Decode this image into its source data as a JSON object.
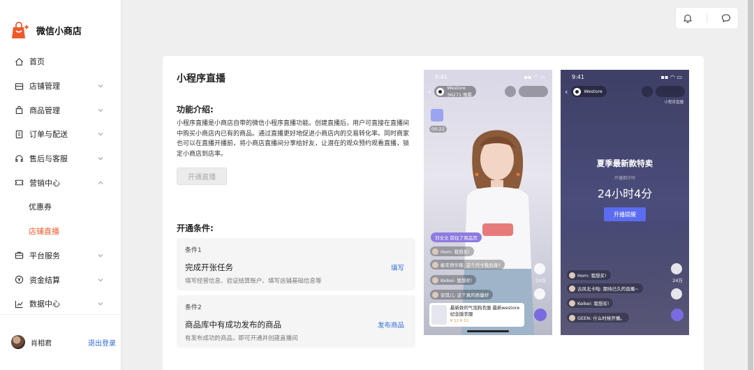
{
  "brand": {
    "name": "微信小商店"
  },
  "nav": {
    "items": [
      {
        "label": "首页",
        "icon": "home-icon",
        "chevron": false
      },
      {
        "label": "店铺管理",
        "icon": "store-icon",
        "chevron": true
      },
      {
        "label": "商品管理",
        "icon": "bag-icon",
        "chevron": true
      },
      {
        "label": "订单与配送",
        "icon": "order-icon",
        "chevron": true
      },
      {
        "label": "售后与客服",
        "icon": "headset-icon",
        "chevron": true
      },
      {
        "label": "营销中心",
        "icon": "ticket-icon",
        "chevron": true,
        "expanded": true
      }
    ],
    "sub_items": [
      {
        "label": "优惠券",
        "active": false
      },
      {
        "label": "店铺直播",
        "active": true
      }
    ],
    "items_after": [
      {
        "label": "平台服务",
        "icon": "briefcase-icon"
      },
      {
        "label": "资金结算",
        "icon": "yen-icon"
      },
      {
        "label": "数据中心",
        "icon": "chart-icon"
      }
    ]
  },
  "user": {
    "name": "肖相君",
    "logout": "退出登录"
  },
  "main": {
    "title": "小程序直播",
    "intro_heading": "功能介绍:",
    "intro_text": "小程序直播是小商店自带的微信小程序直播功能。创建直播后，用户可直接在直播间中购买小商店内已有的商品。通过直播更好地促进小商店内的交易转化率。同时商家也可以在直播开播前，将小商店直播间分享给好友，让潜在的观众预约观看直播，锁定小商店到店率。",
    "open_button": "开通直播",
    "conditions_heading": "开通条件:",
    "conditions": [
      {
        "tag": "条件1",
        "name": "完成开张任务",
        "desc": "填写经营信息、验证结算账户、填写店铺基础信息等",
        "action": "填写"
      },
      {
        "tag": "条件2",
        "name": "商品库中有成功发布的商品",
        "desc": "有发布成功的商品，即可开通并创建直播间",
        "action": "发布商品"
      }
    ]
  },
  "phone1": {
    "time": "9:41",
    "shop": "Westore",
    "viewers": "36271 观看",
    "timer": "00:22",
    "shop_tag": "刘文文 前往了商品页",
    "chats": [
      {
        "text": "Hom: 我想买!"
      },
      {
        "text": "能宅快乐猪: 这个尺寸我合身?"
      },
      {
        "text": "Keikei: 我想买!"
      },
      {
        "text": "安琪儿: 这个真的质量好"
      }
    ],
    "likes": "24万",
    "product_title": "最新款的气泡狗衣服 最新westore纪念版衣服",
    "product_price": "¥ 12 ¥ 12"
  },
  "phone2": {
    "time": "9:41",
    "shop": "Westore",
    "note": "小程序直播",
    "headline": "夏季最新款特卖",
    "countdown_label": "开播倒计时",
    "countdown": "24小时4分",
    "remind_button": "开播提醒",
    "chats": [
      {
        "text": "Hom: 我想买!"
      },
      {
        "text": "古风北卡啦: 期待已久的直播~"
      },
      {
        "text": "Keikei: 我想买!"
      },
      {
        "text": "GEEN: 什么时候开播。"
      }
    ],
    "likes": "24万"
  },
  "colors": {
    "accent": "#f05a2a",
    "link": "#2f6bd8",
    "remind": "#5b6cf0"
  }
}
